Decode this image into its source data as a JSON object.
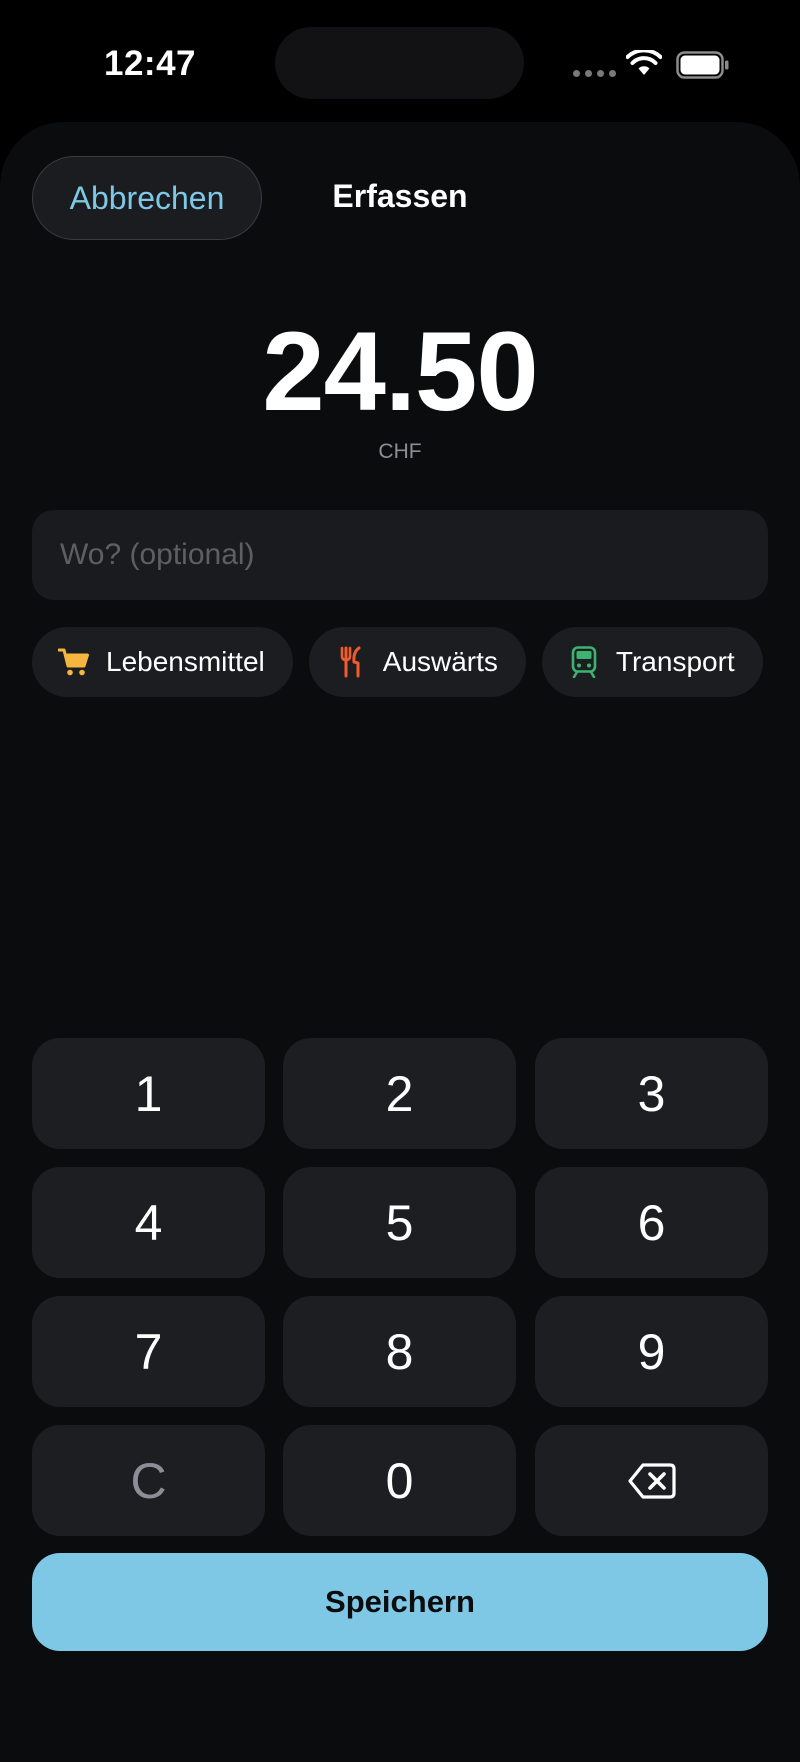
{
  "status_bar": {
    "time": "12:47"
  },
  "header": {
    "cancel_label": "Abbrechen",
    "title": "Erfassen"
  },
  "amount": {
    "value": "24.50",
    "currency": "CHF"
  },
  "where": {
    "placeholder": "Wo? (optional)",
    "value": ""
  },
  "categories": [
    {
      "label": "Lebensmittel",
      "icon": "shopping-cart-icon",
      "color": "#f4b63f"
    },
    {
      "label": "Auswärts",
      "icon": "fork-knife-icon",
      "color": "#f05a2c"
    },
    {
      "label": "Transport",
      "icon": "train-icon",
      "color": "#3cb371"
    }
  ],
  "keypad": {
    "keys": [
      "1",
      "2",
      "3",
      "4",
      "5",
      "6",
      "7",
      "8",
      "9",
      "C",
      "0"
    ],
    "backspace_icon": "delete-left-icon"
  },
  "save_label": "Speichern",
  "colors": {
    "accent": "#7ec8e6",
    "background": "#0b0c0e",
    "key": "#1d1e22"
  }
}
